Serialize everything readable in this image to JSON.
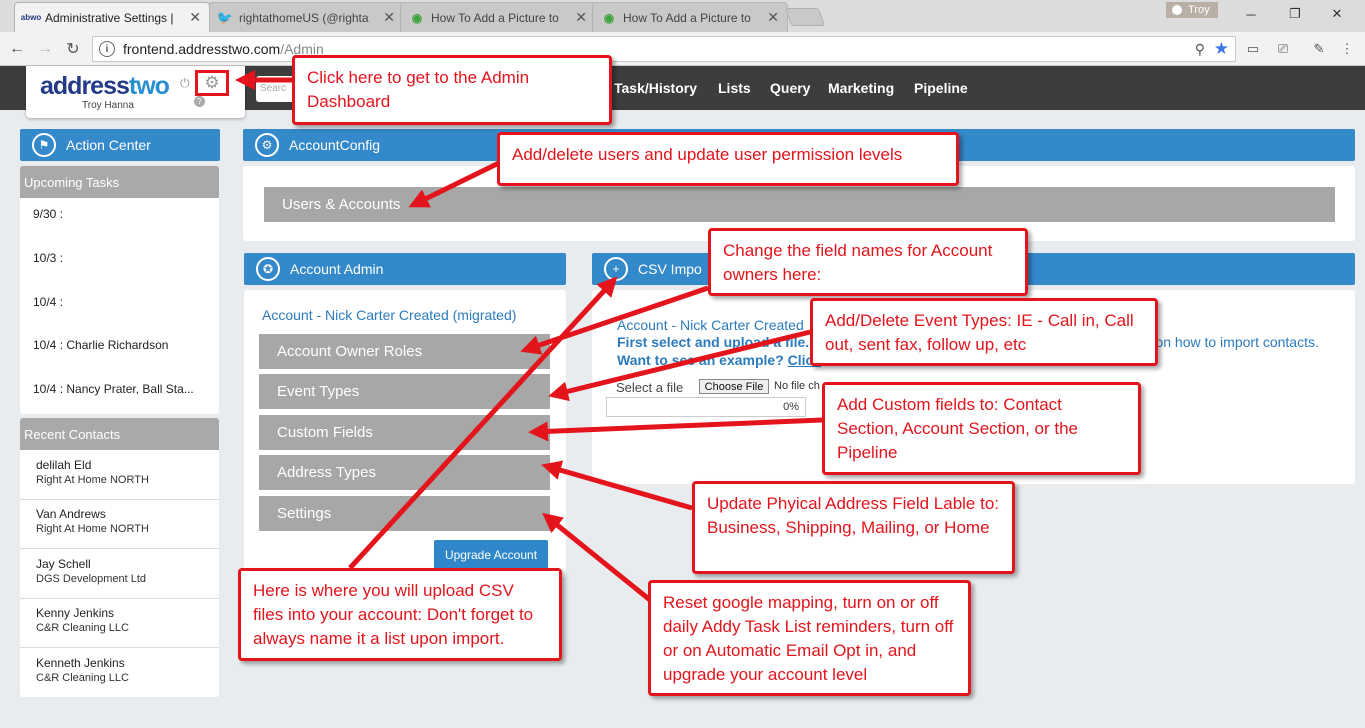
{
  "browser": {
    "tabs": [
      {
        "title": "Administrative Settings |",
        "favicon": "abwo",
        "active": true
      },
      {
        "title": "rightathomeUS (@righta",
        "favicon": "twitter-icon",
        "active": false
      },
      {
        "title": "How To Add a Picture to",
        "favicon": "leaf-icon",
        "active": false
      },
      {
        "title": "How To Add a Picture to",
        "favicon": "leaf-icon",
        "active": false
      }
    ],
    "profile_name": "Troy",
    "url_host": "frontend.addresstwo.com",
    "url_path": "/Admin"
  },
  "app": {
    "logo_part1": "address",
    "logo_part2": "two",
    "user_name": "Troy Hanna",
    "search_placeholder": "Searc",
    "menu": [
      "Task/History",
      "Lists",
      "Query",
      "Marketing",
      "Pipeline"
    ]
  },
  "sidebar": {
    "action_center": "Action Center",
    "upcoming_title": "Upcoming Tasks",
    "tasks": [
      {
        "date": "9/30 :",
        "name": ""
      },
      {
        "date": "10/3 :",
        "name": ""
      },
      {
        "date": "10/4 :",
        "name": ""
      },
      {
        "date": "10/4 :",
        "name": "Charlie Richardson"
      },
      {
        "date": "10/4 :",
        "name": "Nancy Prater, Ball Sta..."
      }
    ],
    "recent_title": "Recent Contacts",
    "contacts": [
      {
        "name": "delilah Eld",
        "company": "Right At Home NORTH"
      },
      {
        "name": "Van Andrews",
        "company": "Right At Home NORTH"
      },
      {
        "name": "Jay Schell",
        "company": "DGS Development Ltd"
      },
      {
        "name": "Kenny Jenkins",
        "company": "C&R Cleaning LLC"
      },
      {
        "name": "Kenneth Jenkins",
        "company": "C&R Cleaning LLC"
      }
    ]
  },
  "main": {
    "account_config": "AccountConfig",
    "users_accounts": "Users & Accounts",
    "account_admin": "Account Admin",
    "account_created": "Account - Nick Carter Created (migrated)",
    "admin_items": [
      "Account Owner Roles",
      "Event Types",
      "Custom Fields",
      "Address Types",
      "Settings"
    ],
    "upgrade_button": "Upgrade Account",
    "csv_title": "CSV Impo",
    "csv_account": "Account - Nick Carter Created",
    "csv_line1": "First select and upload a file.",
    "csv_line1_tail": "eo on how to import contacts.",
    "csv_line2": "Want to see an example?",
    "csv_link": "Click",
    "select_file": "Select a file",
    "choose_file": "Choose File",
    "no_file": "No file ch",
    "progress": "0%"
  },
  "callouts": {
    "admin_dashboard": "Click here to get to the Admin Dashboard",
    "users": "Add/delete users and update user permission levels",
    "owner_roles": "Change the field names for Account owners here:",
    "event_types": "Add/Delete Event Types: IE - Call in, Call out, sent fax, follow up, etc",
    "custom_fields": "Add Custom fields to: Contact Section, Account Section, or the Pipeline",
    "address_types": "Update Phyical Address Field Lable to: Business, Shipping, Mailing, or Home",
    "csv_upload": "Here is where you will upload CSV files into your account: Don't forget to always name it a list upon import.",
    "settings": "Reset google mapping, turn on or off daily Addy Task List reminders, turn off or on Automatic Email Opt in, and upgrade your account level"
  }
}
